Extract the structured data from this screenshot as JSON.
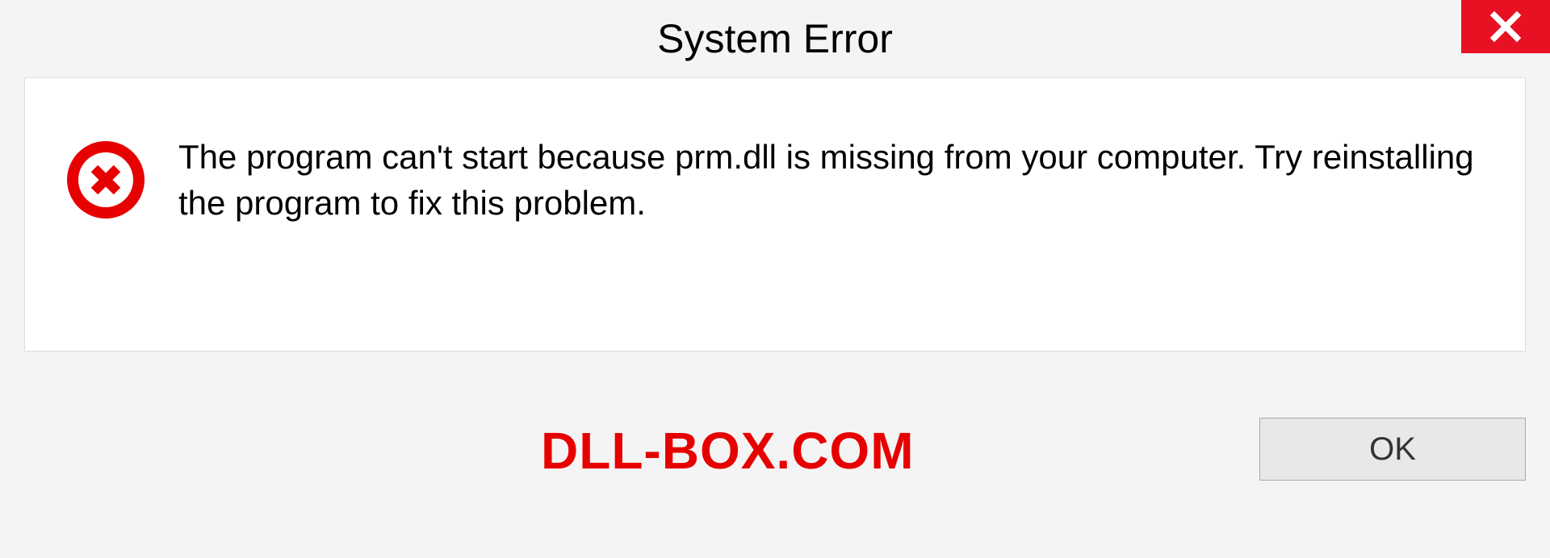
{
  "titlebar": {
    "title": "System Error"
  },
  "content": {
    "message": "The program can't start because prm.dll is missing from your computer. Try reinstalling the program to fix this problem."
  },
  "footer": {
    "watermark": "DLL-BOX.COM",
    "ok_label": "OK"
  },
  "icons": {
    "close": "close-icon",
    "error": "error-icon"
  },
  "colors": {
    "close_bg": "#e81123",
    "error_red": "#e60000",
    "watermark_red": "#e60000"
  }
}
